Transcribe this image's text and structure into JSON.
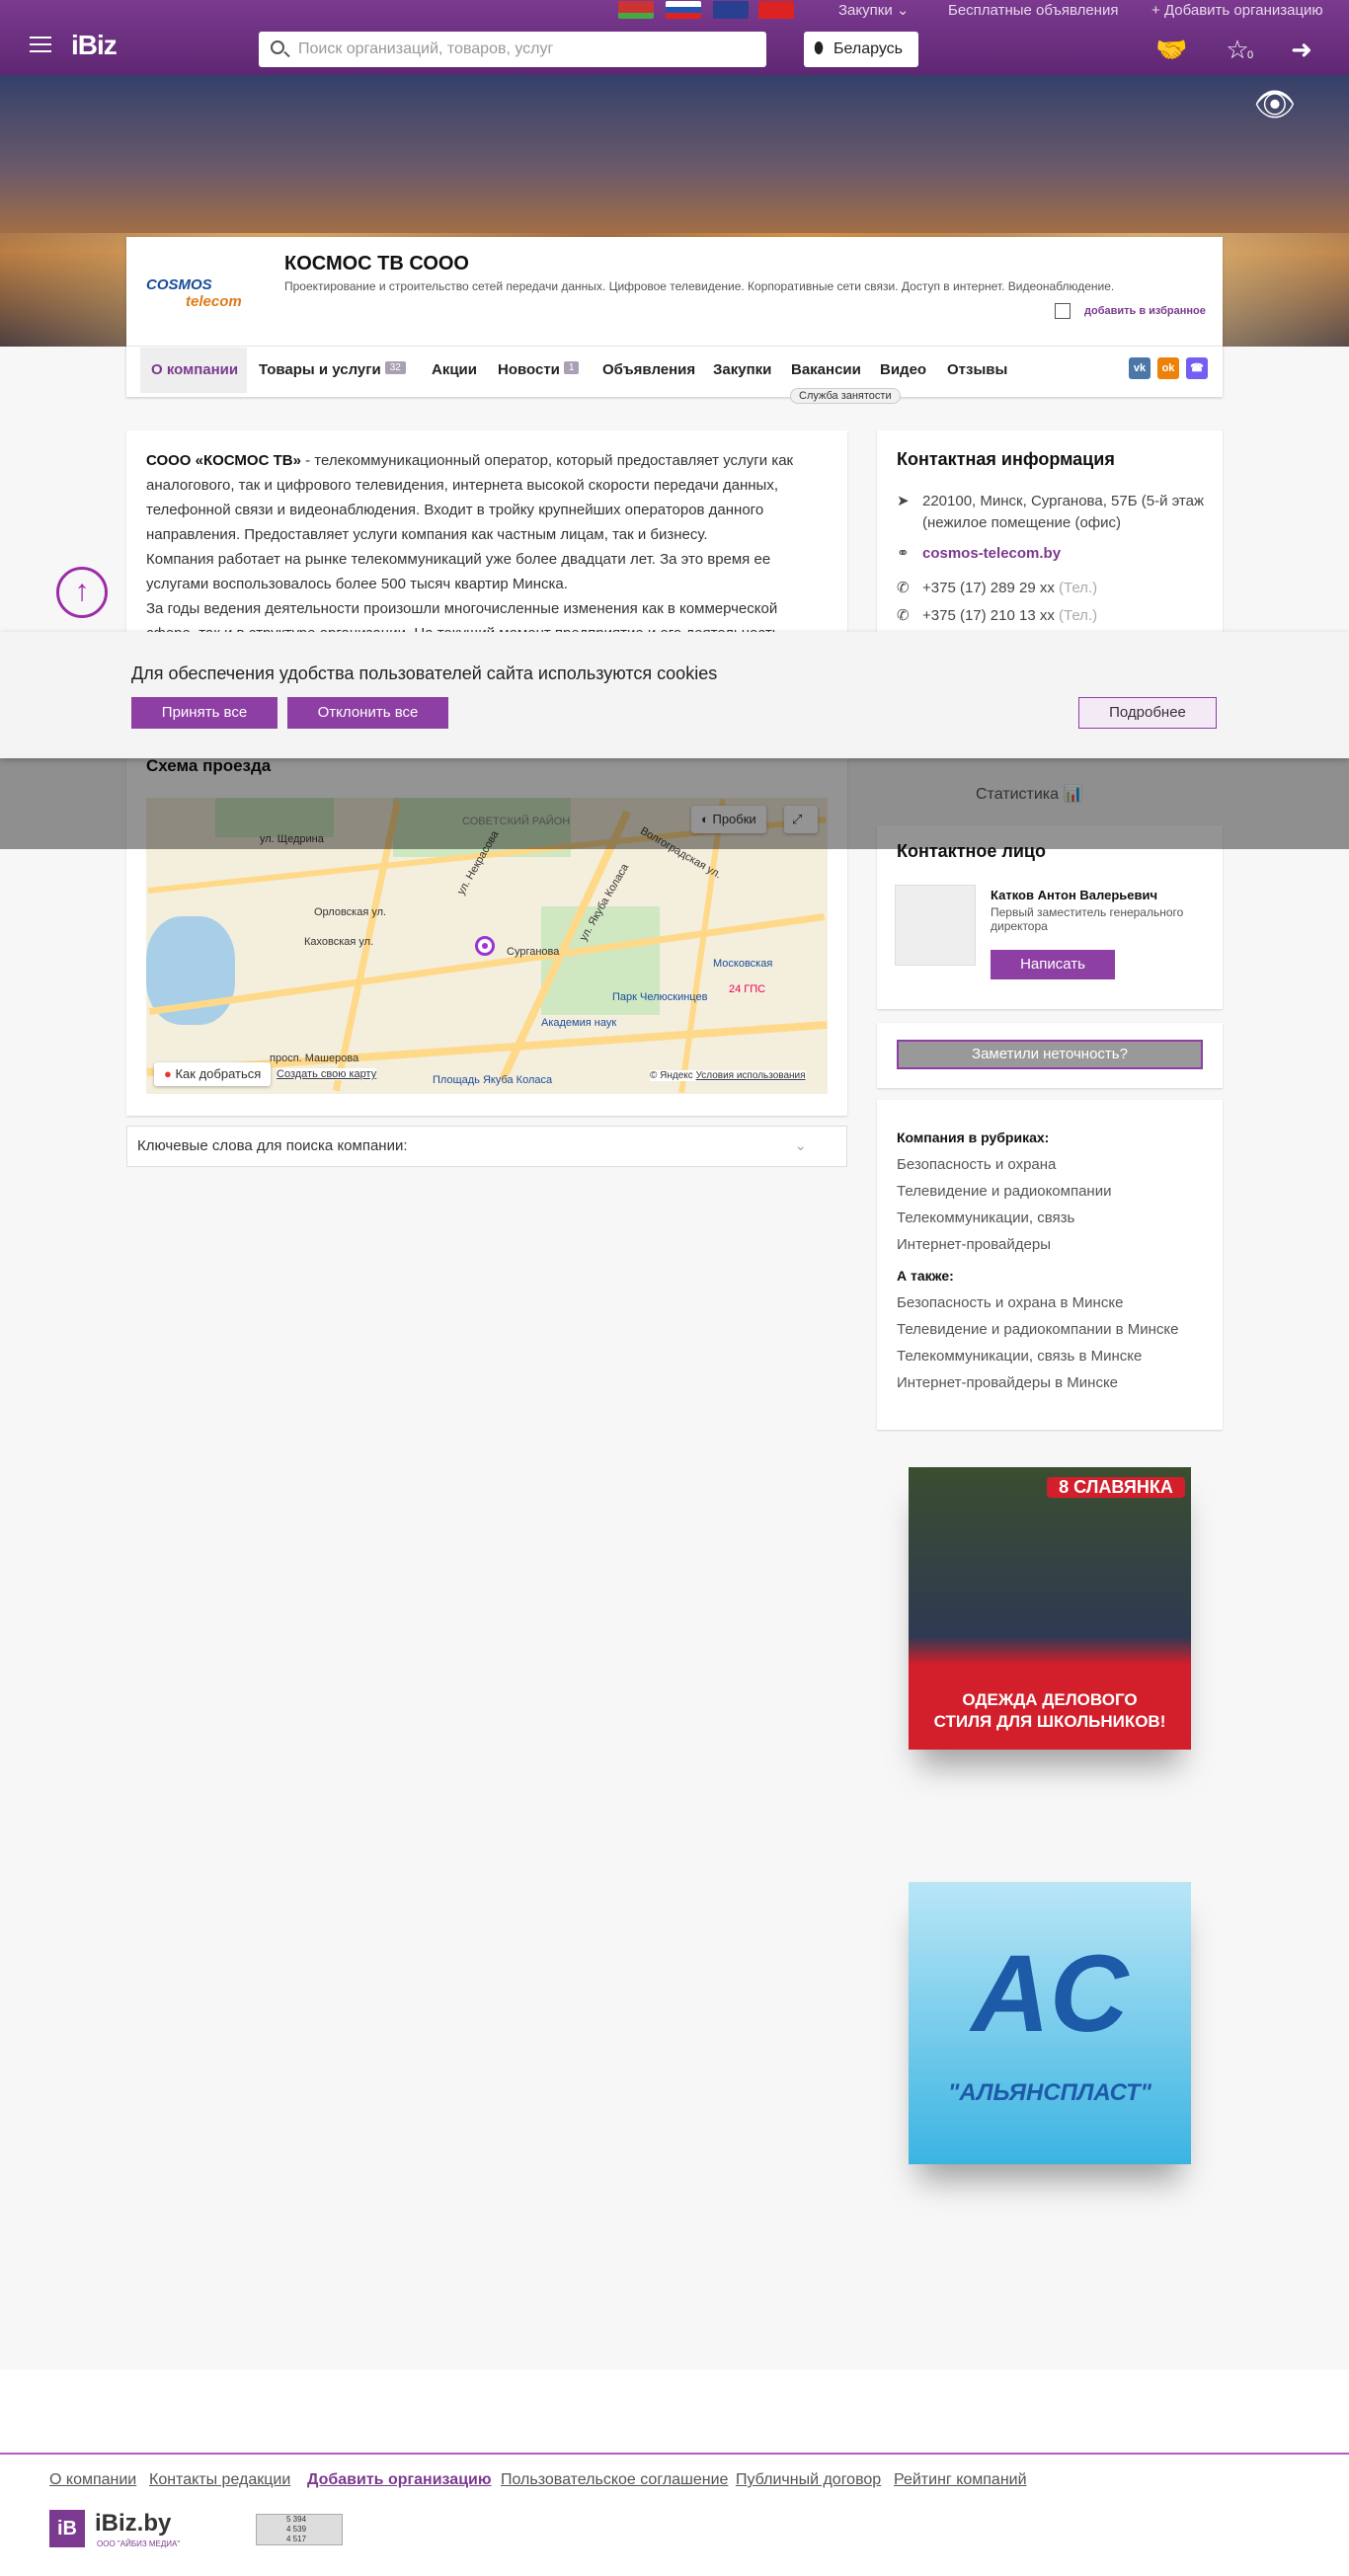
{
  "header": {
    "logo": "iBiz",
    "top_links": {
      "purchases": "Закупки",
      "free_ads": "Бесплатные объявления",
      "add_org": "Добавить организацию"
    },
    "search_placeholder": "Поиск организаций, товаров, услуг",
    "region": "Беларусь",
    "compare_count": "0"
  },
  "company": {
    "logo_text": "COSMOS",
    "logo_sub": "telecom",
    "title": "КОСМОС ТВ СООО",
    "description": "Проектирование и строительство сетей передачи данных. Цифровое телевидение. Корпоративные сети связи. Доступ в интернет. Видеонаблюдение.",
    "favorite": "добавить в избранное"
  },
  "tabs": [
    {
      "label": "О компании"
    },
    {
      "label": "Товары и услуги",
      "count": "32"
    },
    {
      "label": "Акции"
    },
    {
      "label": "Новости",
      "count": "1"
    },
    {
      "label": "Объявления"
    },
    {
      "label": "Закупки"
    },
    {
      "label": "Вакансии"
    },
    {
      "label": "Видео"
    },
    {
      "label": "Отзывы"
    }
  ],
  "employment_tag": "Служба занятости",
  "about": {
    "company_bold": "СООО «КОСМОС ТВ»",
    "p1": " - телекоммуникационный оператор, который предоставляет услуги как аналогового, так и цифрового телевидения, интернета высокой скорости передачи данных, телефонной связи и видеонаблюдения. Входит в тройку крупнейших операторов данного направления. Предоставляет услуги компания как частным лицам, так и бизнесу.",
    "p2": "Компания работает на рынке телекоммуникаций уже более двадцати лет. За это время ее услугами воспользовалось более 500 тысяч квартир Минска.",
    "p3": "За годы ведения деятельности произошли многочисленные изменения как в коммерческой сфере, так и в структуре организации. На текущий момент предприятие и его деятельность"
  },
  "contacts": {
    "title": "Контактная информация",
    "address": "220100, Минск, Сурганова, 57Б (5-й этаж (нежилое помещение (офис)",
    "site": "cosmos-telecom.by",
    "phone1": "+375 (17) 289 29 xx",
    "phone2": "+375 (17) 210 13 xx",
    "phone_tag": "(Тел.)"
  },
  "cookie": {
    "text": "Для обеспечения удобства пользователей сайта используются cookies",
    "accept": "Принять все",
    "decline": "Отклонить все",
    "more": "Подробнее"
  },
  "map": {
    "title": "Схема проезда",
    "traffic": "Пробки",
    "route": "Как добраться",
    "create": "Создать свою карту",
    "copyright": "© Яндекс",
    "terms": "Условия использования",
    "labels": [
      "ул. Щедрина",
      "Орловская ул.",
      "Каховская ул.",
      "СОВЕТСКИЙ РАЙОН",
      "ул. Некрасова",
      "Сурганова",
      "ул. Якуба Коласа",
      "Академия наук",
      "Парк Челюскинцев",
      "Московская",
      "24 ГПС",
      "Площадь Якуба Коласа",
      "просп. Машерова",
      "Волгоградская ул."
    ]
  },
  "keywords": "Ключевые слова для поиска компании:",
  "statistics": "Статистика",
  "person": {
    "title": "Контактное лицо",
    "name": "Катков Антон Валерьевич",
    "position": "Первый заместитель генерального директора",
    "write": "Написать"
  },
  "error_button": "Заметили неточность?",
  "rubrics": {
    "title": "Компания в рубриках:",
    "items": [
      "Безопасность и охрана",
      "Телевидение и радиокомпании",
      "Телекоммуникации, связь",
      "Интернет-провайдеры"
    ],
    "also_title": "А также:",
    "also": [
      "Безопасность и охрана в Минске",
      "Телевидение и радиокомпании в Минске",
      "Телекоммуникации, связь в Минске",
      "Интернет-провайдеры в Минске"
    ]
  },
  "ads": {
    "ad1_brand": "8 СЛАВЯНКА",
    "ad1_line1": "ОДЕЖДА ДЕЛОВОГО",
    "ad1_line2": "СТИЛЯ ДЛЯ ШКОЛЬНИКОВ!",
    "ad2_brand": "\"АЛЬЯНСПЛАСТ\""
  },
  "footer": {
    "links": [
      "О компании",
      "Контакты редакции",
      "Добавить организацию",
      "Пользовательское соглашение",
      "Публичный договор",
      "Рейтинг компаний"
    ],
    "brand": "iBiz.by",
    "brand_sub": "ООО \"АЙБИЗ МЕДИА\"",
    "counter": [
      "5 394",
      "4 539",
      "4 517"
    ]
  },
  "colors": {
    "brand": "#7b3a8f",
    "button": "#8e3fa4"
  }
}
